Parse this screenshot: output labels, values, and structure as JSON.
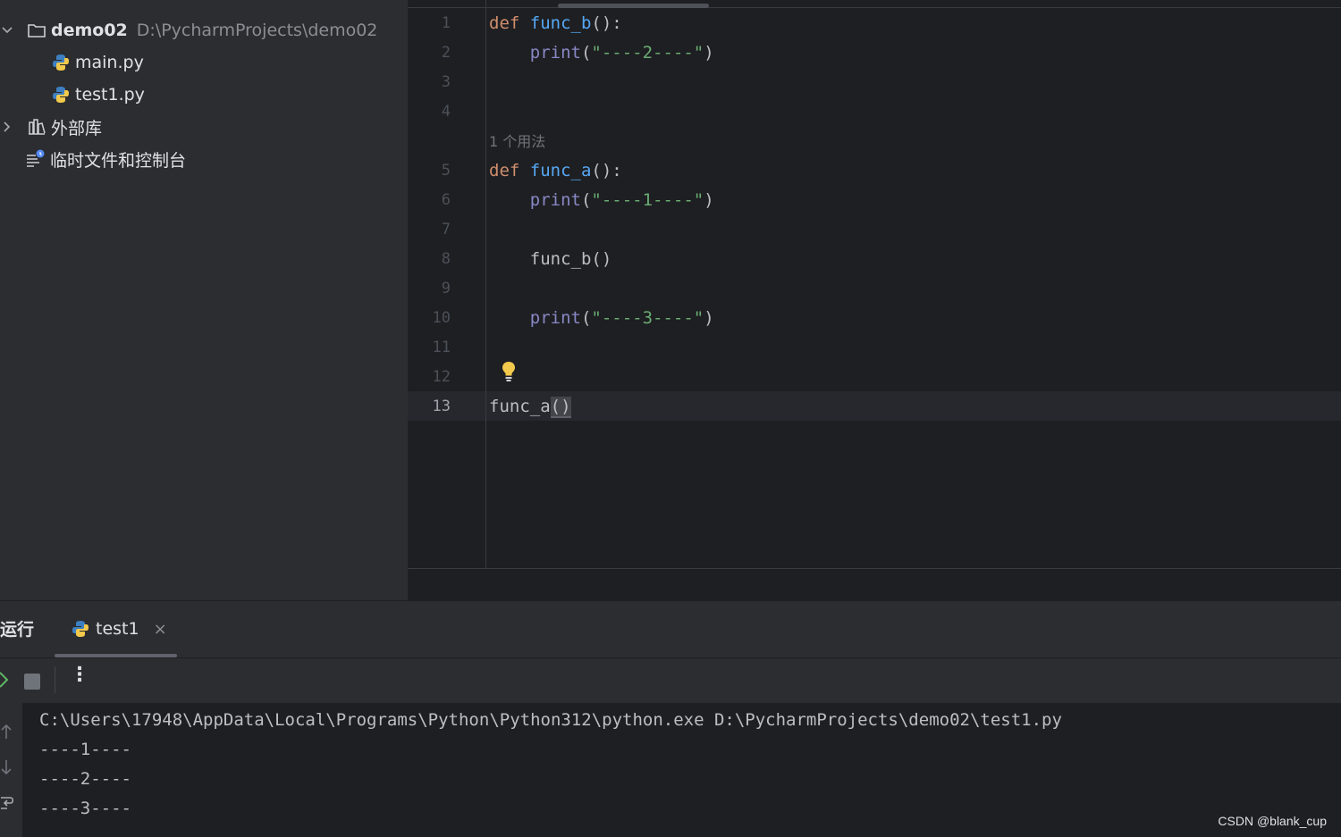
{
  "project": {
    "root": {
      "name": "demo02",
      "path": "D:\\PycharmProjects\\demo02"
    },
    "files": [
      "main.py",
      "test1.py"
    ],
    "external_libs": "外部库",
    "scratches": "临时文件和控制台"
  },
  "editor": {
    "usage_hint": "1 个用法",
    "lines": [
      {
        "n": "1",
        "code": [
          [
            "kw",
            "def "
          ],
          [
            "fn",
            "func_b"
          ],
          [
            "",
            "():"
          ]
        ]
      },
      {
        "n": "2",
        "code": [
          [
            "",
            "    "
          ],
          [
            "bi",
            "print"
          ],
          [
            "",
            "("
          ],
          [
            "str",
            "\"----2----\""
          ],
          [
            "",
            ")"
          ]
        ]
      },
      {
        "n": "3",
        "code": []
      },
      {
        "n": "4",
        "code": []
      },
      {
        "n": "5",
        "code": [
          [
            "kw",
            "def "
          ],
          [
            "fn",
            "func_a"
          ],
          [
            "",
            "():"
          ]
        ]
      },
      {
        "n": "6",
        "code": [
          [
            "",
            "    "
          ],
          [
            "bi",
            "print"
          ],
          [
            "",
            "("
          ],
          [
            "str",
            "\"----1----\""
          ],
          [
            "",
            ")"
          ]
        ]
      },
      {
        "n": "7",
        "code": []
      },
      {
        "n": "8",
        "code": [
          [
            "",
            "    func_b()"
          ]
        ]
      },
      {
        "n": "9",
        "code": []
      },
      {
        "n": "10",
        "code": [
          [
            "",
            "    "
          ],
          [
            "bi",
            "print"
          ],
          [
            "",
            "("
          ],
          [
            "str",
            "\"----3----\""
          ],
          [
            "",
            ")"
          ]
        ]
      },
      {
        "n": "11",
        "code": []
      },
      {
        "n": "12",
        "code": []
      },
      {
        "n": "13",
        "code": [
          [
            "",
            "func_a"
          ],
          [
            "hl",
            "()"
          ]
        ]
      }
    ]
  },
  "run": {
    "title": "运行",
    "tab_label": "test1",
    "tab_close": "×",
    "more": "⋮",
    "console": [
      "C:\\Users\\17948\\AppData\\Local\\Programs\\Python\\Python312\\python.exe D:\\PycharmProjects\\demo02\\test1.py",
      "----1----",
      "----2----",
      "----3----"
    ]
  },
  "watermark": "CSDN @blank_cup"
}
